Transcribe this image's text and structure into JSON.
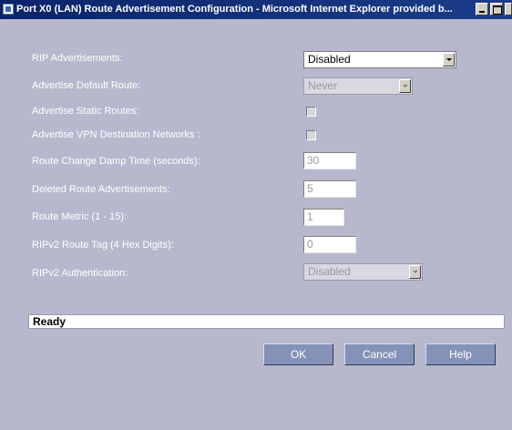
{
  "window": {
    "title": "Port X0 (LAN) Route Advertisement Configuration - Microsoft Internet Explorer provided b..."
  },
  "form": {
    "rip_advertisements": {
      "label": "RIP Advertisements:",
      "value": "Disabled"
    },
    "advertise_default_route": {
      "label": "Advertise Default Route:",
      "value": "Never"
    },
    "advertise_static_routes": {
      "label": "Advertise Static Routes:",
      "checked": false
    },
    "advertise_vpn_networks": {
      "label": "Advertise VPN Destination Networks :",
      "checked": false
    },
    "route_change_damp_time": {
      "label": "Route Change Damp Time (seconds):",
      "value": "30"
    },
    "deleted_route_advertisements": {
      "label": "Deleted Route Advertisements:",
      "value": "5"
    },
    "route_metric": {
      "label": "Route Metric (1 - 15):",
      "value": "1"
    },
    "ripv2_route_tag": {
      "label": "RIPv2 Route Tag (4 Hex Digits):",
      "value": "0"
    },
    "ripv2_authentication": {
      "label": "RIPv2 Authentication:",
      "value": "Disabled"
    }
  },
  "status": {
    "text": "Ready"
  },
  "buttons": {
    "ok": "OK",
    "cancel": "Cancel",
    "help": "Help"
  },
  "colors": {
    "background": "#b7b8cd",
    "button": "#8592b8",
    "title_bar": "#0a246a"
  }
}
